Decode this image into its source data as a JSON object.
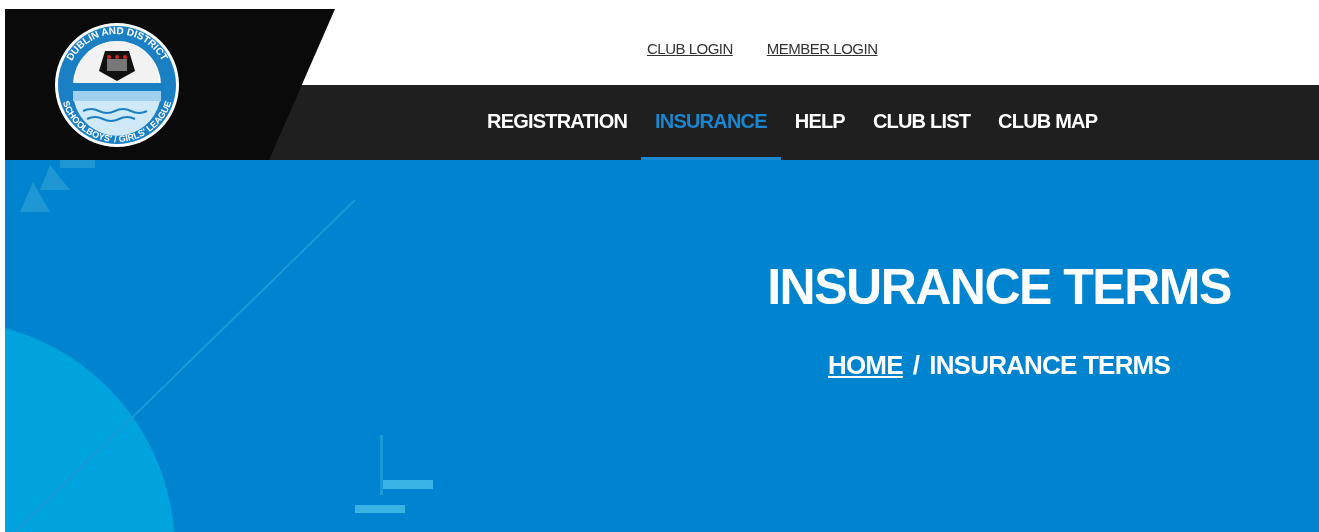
{
  "logo": {
    "top_text": "DUBLIN AND DISTRICT",
    "bottom_text": "SCHOOLBOYS' / GIRLS' LEAGUE"
  },
  "top_links": [
    "CLUB LOGIN",
    "MEMBER LOGIN"
  ],
  "nav": [
    {
      "label": "REGISTRATION",
      "selected": false
    },
    {
      "label": "INSURANCE",
      "selected": true
    },
    {
      "label": "HELP",
      "selected": false
    },
    {
      "label": "CLUB LIST",
      "selected": false
    },
    {
      "label": "CLUB MAP",
      "selected": false
    }
  ],
  "hero": {
    "title": "INSURANCE TERMS",
    "breadcrumb": [
      {
        "label": "HOME",
        "kind": "link"
      },
      {
        "label": "INSURANCE TERMS",
        "kind": "current"
      }
    ],
    "separator": "/"
  }
}
